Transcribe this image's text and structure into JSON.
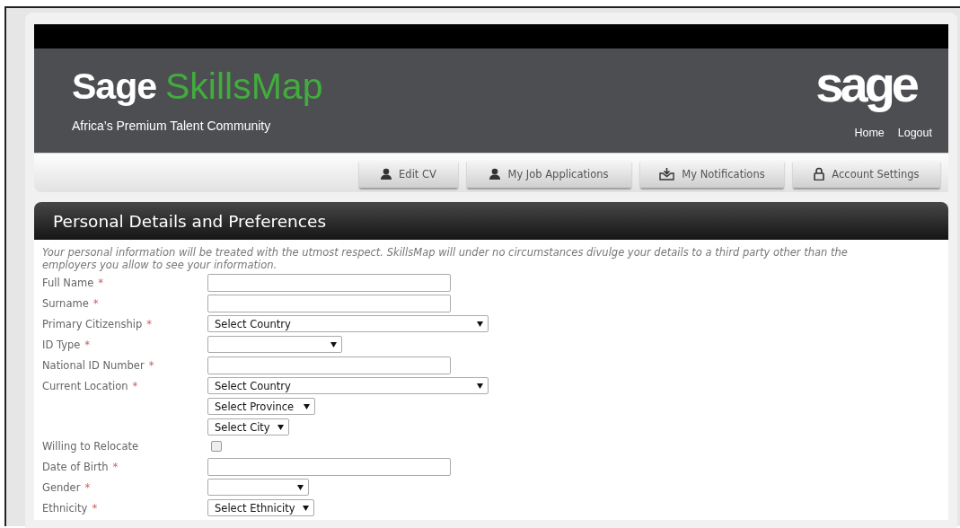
{
  "header": {
    "logo": {
      "primary": "Sage",
      "secondary": "SkillsMap"
    },
    "tagline": "Africa’s Premium Talent Community",
    "brand_mark": "sage",
    "links": [
      "Home",
      "Logout"
    ]
  },
  "nav": [
    {
      "label": "Edit CV"
    },
    {
      "label": "My Job Applications"
    },
    {
      "label": "My Notifications"
    },
    {
      "label": "Account Settings"
    }
  ],
  "section": {
    "title": "Personal Details and Preferences",
    "intro": "Your personal information will be treated with the utmost respect. SkillsMap will under no circumstances divulge your details to a third party other than the employers you allow to see your information."
  },
  "fields": [
    {
      "label": "Full Name",
      "required_mark": "*",
      "controls": [
        {
          "kind": "text"
        }
      ]
    },
    {
      "label": "Surname",
      "required_mark": "*",
      "controls": [
        {
          "kind": "text"
        }
      ]
    },
    {
      "label": "Primary Citizenship",
      "required_mark": "*",
      "controls": [
        {
          "kind": "select",
          "value": "Select Country"
        }
      ]
    },
    {
      "label": "ID Type",
      "required_mark": "*",
      "controls": [
        {
          "kind": "select"
        }
      ]
    },
    {
      "label": "National ID Number",
      "required_mark": "*",
      "controls": [
        {
          "kind": "text"
        }
      ]
    },
    {
      "label": "Current Location",
      "required_mark": "*",
      "controls": [
        {
          "kind": "select",
          "value": "Select Country"
        },
        {
          "kind": "select",
          "value": "Select Province"
        },
        {
          "kind": "select",
          "value": "Select City"
        }
      ]
    },
    {
      "label": "Willing to Relocate",
      "controls": [
        {
          "kind": "checkbox",
          "checked": false
        }
      ]
    },
    {
      "label": "Date of Birth",
      "required_mark": "*",
      "controls": [
        {
          "kind": "text"
        }
      ]
    },
    {
      "label": "Gender",
      "required_mark": "*",
      "controls": [
        {
          "kind": "select"
        }
      ]
    },
    {
      "label": "Ethnicity",
      "required_mark": "*",
      "controls": [
        {
          "kind": "select",
          "value": "Select Ethnicity"
        }
      ]
    }
  ]
}
